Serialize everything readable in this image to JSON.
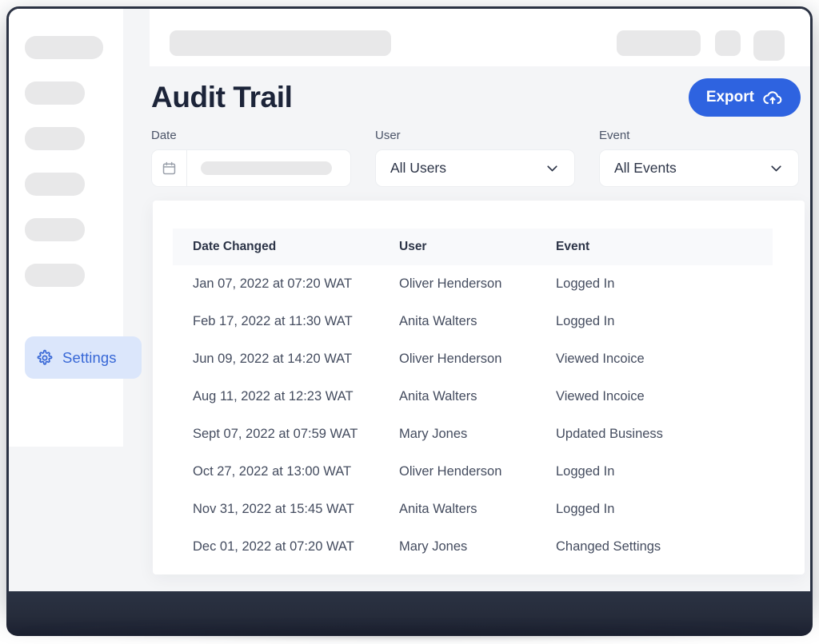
{
  "colors": {
    "accent": "#2e63e0",
    "accent_soft_bg": "#dbe6fb",
    "accent_text": "#3767d6",
    "title": "#1c2439",
    "body_text": "#444c5f",
    "app_bg": "#f4f5f7",
    "card_bg": "#ffffff",
    "table_header_bg": "#f8f9fb",
    "skeleton": "#e8e8e9",
    "frame": "#2b3243"
  },
  "sidebar": {
    "skeleton_items": [
      {
        "name": "nav-skeleton-1",
        "width": "wide"
      },
      {
        "name": "nav-skeleton-2",
        "width": "std"
      },
      {
        "name": "nav-skeleton-3",
        "width": "std"
      },
      {
        "name": "nav-skeleton-4",
        "width": "std"
      },
      {
        "name": "nav-skeleton-5",
        "width": "std"
      },
      {
        "name": "nav-skeleton-6",
        "width": "std"
      }
    ],
    "settings": {
      "label": "Settings",
      "icon": "gear-icon",
      "active": true
    }
  },
  "topbar": {
    "skeletons": [
      "search-skeleton",
      "action-pill-skeleton",
      "icon-button-skeleton-1",
      "icon-button-skeleton-2"
    ]
  },
  "header": {
    "title": "Audit Trail",
    "export": {
      "label": "Export",
      "icon": "cloud-upload-icon"
    }
  },
  "filters": {
    "date": {
      "label": "Date",
      "value": "",
      "placeholder": "",
      "icon": "calendar-icon"
    },
    "user": {
      "label": "User",
      "value": "All Users",
      "icon": "chevron-down-icon"
    },
    "event": {
      "label": "Event",
      "value": "All Events",
      "icon": "chevron-down-icon"
    }
  },
  "table": {
    "columns": [
      "Date Changed",
      "User",
      "Event"
    ],
    "rows": [
      [
        "Jan 07, 2022 at 07:20 WAT",
        "Oliver Henderson",
        "Logged In"
      ],
      [
        "Feb 17, 2022 at 11:30 WAT",
        "Anita Walters",
        "Logged In"
      ],
      [
        "Jun 09, 2022 at 14:20 WAT",
        "Oliver Henderson",
        "Viewed Incoice"
      ],
      [
        "Aug 11, 2022 at 12:23 WAT",
        "Anita Walters",
        "Viewed Incoice"
      ],
      [
        "Sept 07, 2022 at 07:59 WAT",
        "Mary Jones",
        "Updated Business"
      ],
      [
        "Oct 27, 2022 at 13:00 WAT",
        "Oliver Henderson",
        "Logged In"
      ],
      [
        "Nov 31, 2022 at 15:45 WAT",
        "Anita Walters",
        "Logged In"
      ],
      [
        "Dec 01, 2022 at 07:20 WAT",
        "Mary Jones",
        "Changed Settings"
      ]
    ]
  }
}
